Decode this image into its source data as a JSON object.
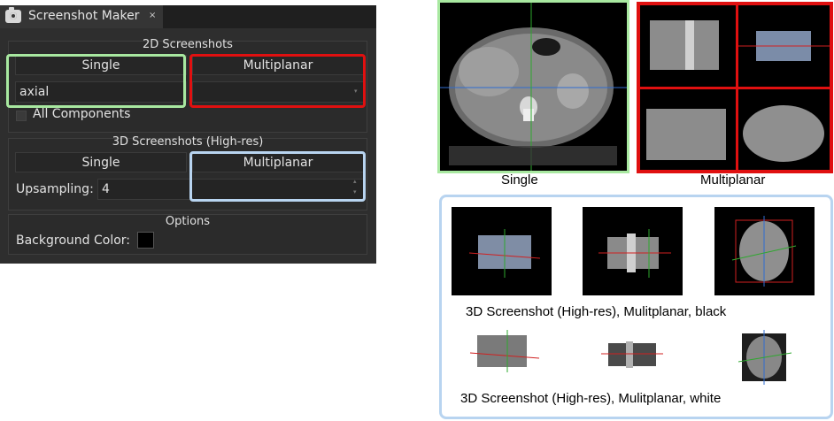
{
  "panel": {
    "title": "Screenshot Maker",
    "close_glyph": "×",
    "section_2d": {
      "title": "2D Screenshots",
      "single_label": "Single",
      "multiplanar_label": "Multiplanar",
      "plane_value": "axial",
      "all_components_label": "All Components"
    },
    "section_3d": {
      "title": "3D Screenshots (High-res)",
      "single_label": "Single",
      "multiplanar_label": "Multiplanar",
      "upsampling_label": "Upsampling:",
      "upsampling_value": "4"
    },
    "options": {
      "title": "Options",
      "background_label": "Background Color:",
      "background_color": "#000000"
    }
  },
  "examples": {
    "single_caption": "Single",
    "multiplanar_caption": "Multiplanar",
    "hr_black_caption": "3D Screenshot (High-res), Mulitplanar, black",
    "hr_white_caption": "3D Screenshot (High-res), Mulitplanar, white"
  },
  "colors": {
    "single": "#a8e8a0",
    "multiplanar": "#e01010",
    "highres": "#b8d4f0"
  }
}
